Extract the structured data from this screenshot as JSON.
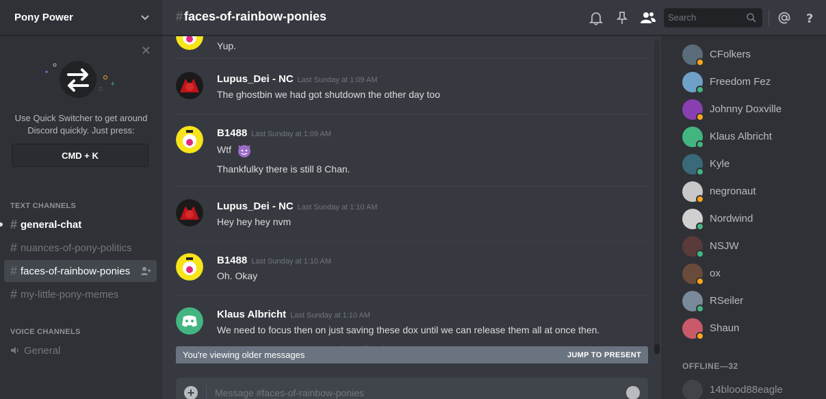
{
  "server": {
    "name": "Pony Power"
  },
  "quick_switcher": {
    "text": "Use Quick Switcher to get around Discord quickly. Just press:",
    "shortcut": "CMD + K"
  },
  "categories": {
    "text": "TEXT CHANNELS",
    "voice": "VOICE CHANNELS"
  },
  "text_channels": [
    {
      "name": "general-chat",
      "state": "unread"
    },
    {
      "name": "nuances-of-pony-politics",
      "state": "muted"
    },
    {
      "name": "faces-of-rainbow-ponies",
      "state": "selected"
    },
    {
      "name": "my-little-pony-memes",
      "state": "muted"
    }
  ],
  "voice_channels": [
    {
      "name": "General"
    }
  ],
  "header": {
    "channel": "faces-of-rainbow-ponies",
    "search_placeholder": "Search",
    "icons": [
      "bell-icon",
      "pin-icon",
      "members-icon",
      "search-icon",
      "mention-icon",
      "help-icon"
    ]
  },
  "messages": [
    {
      "author": "",
      "timestamp": "",
      "lines": [
        "Yup."
      ],
      "avatar": "pony-avatar"
    },
    {
      "author": "Lupus_Dei - NC",
      "timestamp": "Last Sunday at 1:09 AM",
      "lines": [
        "The ghostbin we had got shutdown the other day too"
      ],
      "avatar": "red-avatar"
    },
    {
      "author": "B1488",
      "timestamp": "Last Sunday at 1:09 AM",
      "lines": [
        "Wtf",
        "Thankfulky there is still 8 Chan."
      ],
      "avatar": "pony-avatar"
    },
    {
      "author": "Lupus_Dei - NC",
      "timestamp": "Last Sunday at 1:10 AM",
      "lines": [
        "Hey hey hey nvm"
      ],
      "avatar": "red-avatar"
    },
    {
      "author": "B1488",
      "timestamp": "Last Sunday at 1:10 AM",
      "lines": [
        "Oh. Okay"
      ],
      "avatar": "pony-avatar"
    },
    {
      "author": "Klaus Albricht",
      "timestamp": "Last Sunday at 1:10 AM",
      "lines": [
        "We need to focus then on just saving these dox until we can release them all at once then."
      ],
      "avatar": "discord-avatar"
    }
  ],
  "older_bar": {
    "left": "You're viewing older messages",
    "right": "JUMP TO PRESENT",
    "behind_text": "e to 4chan IE pol."
  },
  "composer": {
    "placeholder": "Message #faces-of-rainbow-ponies"
  },
  "members_online": [
    {
      "name": "CFolkers",
      "status": "idle",
      "avatar_color": "#5a6b7a"
    },
    {
      "name": "Freedom Fez",
      "status": "online",
      "avatar_color": "#6fa0c8"
    },
    {
      "name": "Johnny Doxville",
      "status": "idle",
      "avatar_color": "#8a3fb0"
    },
    {
      "name": "Klaus Albricht",
      "status": "online",
      "avatar_color": "#43b581"
    },
    {
      "name": "Kyle",
      "status": "online",
      "avatar_color": "#3a6a7a"
    },
    {
      "name": "negronaut",
      "status": "idle",
      "avatar_color": "#c8c8c8"
    },
    {
      "name": "Nordwind",
      "status": "online",
      "avatar_color": "#d0d0d0"
    },
    {
      "name": "NSJW",
      "status": "online",
      "avatar_color": "#5a3a3a"
    },
    {
      "name": "ox",
      "status": "idle",
      "avatar_color": "#6a4a3a"
    },
    {
      "name": "RSeiler",
      "status": "online",
      "avatar_color": "#7a8a9a"
    },
    {
      "name": "Shaun",
      "status": "idle",
      "avatar_color": "#c85a6a"
    }
  ],
  "offline": {
    "label": "OFFLINE—32",
    "members": [
      {
        "name": "14blood88eagle",
        "avatar_color": "#555"
      }
    ]
  },
  "colors": {
    "online": "#43b581",
    "idle": "#faa61a",
    "blurple": "#7289da"
  }
}
